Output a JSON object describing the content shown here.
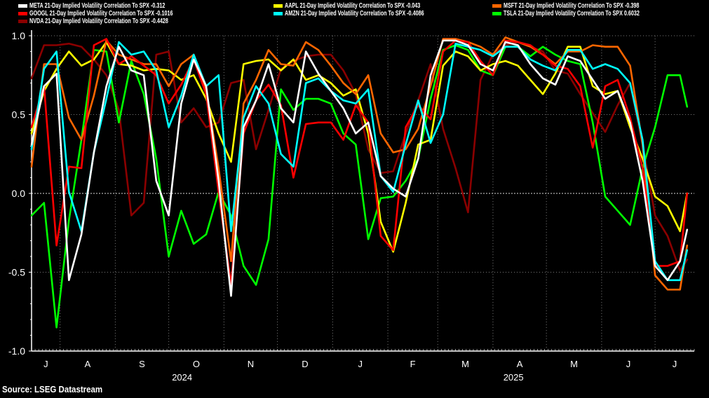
{
  "legend": [
    {
      "label": "META 21-Day Implied Volatility Correlation To SPX -0.312",
      "color": "#ffffff"
    },
    {
      "label": "AAPL 21-Day Implied Volatility Correlation To SPX -0.043",
      "color": "#ffff00"
    },
    {
      "label": "MSFT 21-Day Implied Volatility Correlation To SPX -0.398",
      "color": "#ff6600"
    },
    {
      "label": "GOOGL 21-Day Implied Volatility Correlation To SPX -0.1016",
      "color": "#ff0000"
    },
    {
      "label": "AMZN 21-Day Implied Volatility Correlation To SPX -0.4086",
      "color": "#00ffff"
    },
    {
      "label": "TSLA 21-Day Implied Volatility Correlation To SPX 0.6032",
      "color": "#00ff00"
    },
    {
      "label": "NVDA 21-Day Implied Volatility Correlation To SPX -0.4428",
      "color": "#8b0000"
    }
  ],
  "source": "Source: LSEG Datastream",
  "chart_data": {
    "type": "line",
    "title": "",
    "xlabel": "",
    "ylabel": "",
    "ylim": [
      -1.0,
      1.0
    ],
    "xlim": [
      "2024-07-16",
      "2025-07-23"
    ],
    "grid": true,
    "legend_position": "top",
    "y_ticks": [
      {
        "value": 1.0,
        "label": "1.0"
      },
      {
        "value": 0.5,
        "label": "0.5"
      },
      {
        "value": 0.0,
        "label": "0.0"
      },
      {
        "value": -0.5,
        "label": "-0.5"
      },
      {
        "value": -1.0,
        "label": "-1.0"
      }
    ],
    "x_month_ticks": [
      {
        "month": "2024-07",
        "label": "J"
      },
      {
        "month": "2024-08",
        "label": "A"
      },
      {
        "month": "2024-09",
        "label": "S"
      },
      {
        "month": "2024-10",
        "label": "O"
      },
      {
        "month": "2024-11",
        "label": "N"
      },
      {
        "month": "2024-12",
        "label": "D"
      },
      {
        "month": "2025-01",
        "label": "J"
      },
      {
        "month": "2025-02",
        "label": "F"
      },
      {
        "month": "2025-03",
        "label": "M"
      },
      {
        "month": "2025-04",
        "label": "A"
      },
      {
        "month": "2025-05",
        "label": "M"
      },
      {
        "month": "2025-06",
        "label": "J"
      },
      {
        "month": "2025-07",
        "label": "J"
      }
    ],
    "x_year_ticks": [
      {
        "year": 2024,
        "label": "2024"
      },
      {
        "year": 2025,
        "label": "2025"
      }
    ],
    "x": [
      "2024-07-16",
      "2024-07-23",
      "2024-07-30",
      "2024-08-06",
      "2024-08-13",
      "2024-08-20",
      "2024-08-27",
      "2024-09-03",
      "2024-09-10",
      "2024-09-17",
      "2024-09-24",
      "2024-10-01",
      "2024-10-08",
      "2024-10-15",
      "2024-10-22",
      "2024-10-29",
      "2024-11-05",
      "2024-11-12",
      "2024-11-19",
      "2024-11-26",
      "2024-12-03",
      "2024-12-10",
      "2024-12-17",
      "2024-12-24",
      "2024-12-31",
      "2025-01-07",
      "2025-01-14",
      "2025-01-21",
      "2025-01-28",
      "2025-02-04",
      "2025-02-11",
      "2025-02-18",
      "2025-02-25",
      "2025-03-04",
      "2025-03-11",
      "2025-03-18",
      "2025-03-25",
      "2025-04-01",
      "2025-04-08",
      "2025-04-15",
      "2025-04-22",
      "2025-04-29",
      "2025-05-06",
      "2025-05-13",
      "2025-05-20",
      "2025-05-27",
      "2025-06-03",
      "2025-06-10",
      "2025-06-17",
      "2025-06-24",
      "2025-07-01",
      "2025-07-08",
      "2025-07-15",
      "2025-07-19"
    ],
    "series": [
      {
        "name": "NVDA",
        "color": "#8b0000",
        "values": [
          0.73,
          0.94,
          0.94,
          0.95,
          0.93,
          0.85,
          0.75,
          0.53,
          -0.14,
          -0.06,
          0.88,
          0.9,
          0.45,
          0.54,
          0.42,
          0.45,
          0.7,
          0.72,
          0.28,
          0.53,
          0.79,
          0.84,
          0.87,
          0.88,
          0.88,
          0.78,
          0.63,
          0.28,
          0.13,
          0.14,
          0.38,
          0.59,
          0.82,
          0.41,
          0.16,
          -0.12,
          0.72,
          0.88,
          0.94,
          0.96,
          0.93,
          0.9,
          0.78,
          0.76,
          0.63,
          0.51,
          0.39,
          0.56,
          0.7,
          0.31,
          -0.14,
          -0.27,
          -0.49,
          -0.42
        ]
      },
      {
        "name": "TSLA",
        "color": "#00ff00",
        "values": [
          -0.14,
          -0.06,
          -0.85,
          -0.17,
          0.34,
          0.91,
          0.9,
          0.45,
          0.84,
          0.63,
          0.22,
          -0.4,
          -0.11,
          -0.32,
          -0.26,
          0.01,
          -0.14,
          -0.46,
          -0.58,
          -0.29,
          0.66,
          0.53,
          0.6,
          0.6,
          0.57,
          0.38,
          0.31,
          -0.29,
          -0.03,
          -0.02,
          0.08,
          0.22,
          0.6,
          0.91,
          0.94,
          0.91,
          0.78,
          0.75,
          0.93,
          0.93,
          0.87,
          0.93,
          0.88,
          0.84,
          0.82,
          0.45,
          -0.02,
          -0.11,
          -0.2,
          0.16,
          0.42,
          0.75,
          0.75,
          0.55
        ]
      },
      {
        "name": "AAPL",
        "color": "#ffff00",
        "values": [
          0.38,
          0.65,
          0.79,
          0.9,
          0.81,
          0.85,
          0.96,
          0.82,
          0.81,
          0.78,
          0.79,
          0.78,
          0.72,
          0.75,
          0.6,
          0.38,
          0.2,
          0.82,
          0.84,
          0.85,
          0.78,
          0.85,
          0.72,
          0.75,
          0.7,
          0.62,
          0.66,
          0.38,
          -0.18,
          -0.37,
          -0.06,
          0.31,
          0.34,
          0.81,
          0.9,
          0.87,
          0.78,
          0.82,
          0.84,
          0.81,
          0.72,
          0.63,
          0.76,
          0.93,
          0.93,
          0.68,
          0.63,
          0.65,
          0.42,
          0.22,
          -0.02,
          -0.08,
          -0.24,
          0.0
        ]
      },
      {
        "name": "MSFT",
        "color": "#ff6600",
        "values": [
          0.17,
          0.82,
          0.82,
          0.48,
          0.34,
          0.62,
          0.97,
          0.88,
          0.85,
          0.82,
          0.82,
          0.68,
          0.82,
          0.88,
          0.66,
          0.16,
          -0.43,
          0.57,
          0.72,
          0.91,
          0.82,
          0.81,
          0.96,
          0.91,
          0.81,
          0.7,
          0.63,
          0.75,
          0.38,
          0.26,
          0.28,
          0.41,
          0.68,
          0.98,
          0.98,
          0.96,
          0.93,
          0.88,
          0.99,
          0.96,
          0.93,
          0.88,
          0.82,
          0.9,
          0.9,
          0.94,
          0.93,
          0.93,
          0.81,
          0.31,
          -0.52,
          -0.61,
          -0.61,
          -0.33
        ]
      },
      {
        "name": "GOOGL",
        "color": "#ff0000",
        "values": [
          0.42,
          0.68,
          -0.33,
          0.17,
          0.16,
          0.94,
          0.98,
          0.82,
          0.87,
          0.81,
          0.75,
          0.57,
          0.69,
          0.85,
          0.63,
          0.01,
          -0.58,
          0.38,
          0.59,
          0.69,
          0.56,
          0.1,
          0.44,
          0.45,
          0.45,
          0.34,
          0.56,
          0.45,
          -0.27,
          -0.36,
          0.42,
          0.56,
          0.47,
          0.9,
          0.97,
          0.96,
          0.84,
          0.75,
          0.97,
          0.96,
          0.94,
          0.88,
          0.81,
          0.79,
          0.68,
          0.29,
          0.68,
          0.72,
          0.48,
          0.16,
          -0.46,
          -0.46,
          -0.43,
          0.0
        ]
      },
      {
        "name": "AMZN",
        "color": "#00ffff",
        "values": [
          0.28,
          0.79,
          0.9,
          0.01,
          -0.24,
          0.26,
          0.6,
          0.96,
          0.88,
          0.9,
          0.78,
          0.42,
          0.62,
          0.88,
          0.68,
          0.75,
          -0.24,
          0.48,
          0.68,
          0.57,
          0.25,
          0.17,
          0.7,
          0.73,
          0.65,
          0.59,
          0.57,
          0.66,
          0.11,
          0.01,
          0.31,
          0.59,
          0.32,
          0.5,
          0.95,
          0.93,
          0.91,
          0.87,
          0.93,
          0.93,
          0.85,
          0.81,
          0.78,
          0.91,
          0.91,
          0.79,
          0.82,
          0.79,
          0.7,
          0.34,
          -0.43,
          -0.55,
          -0.55,
          -0.36
        ]
      },
      {
        "name": "META",
        "color": "#ffffff",
        "values": [
          0.31,
          0.68,
          0.76,
          -0.55,
          -0.26,
          0.26,
          0.68,
          0.93,
          0.78,
          0.75,
          0.08,
          -0.14,
          0.57,
          0.85,
          0.68,
          0.08,
          -0.65,
          0.42,
          0.59,
          0.82,
          0.54,
          0.45,
          0.9,
          0.76,
          0.65,
          0.54,
          0.38,
          0.45,
          0.11,
          0.03,
          -0.02,
          0.22,
          0.75,
          0.97,
          0.97,
          0.94,
          0.82,
          0.78,
          0.96,
          0.94,
          0.82,
          0.73,
          0.69,
          0.87,
          0.84,
          0.72,
          0.6,
          0.65,
          0.45,
          0.08,
          -0.46,
          -0.55,
          -0.43,
          -0.23
        ]
      }
    ]
  }
}
